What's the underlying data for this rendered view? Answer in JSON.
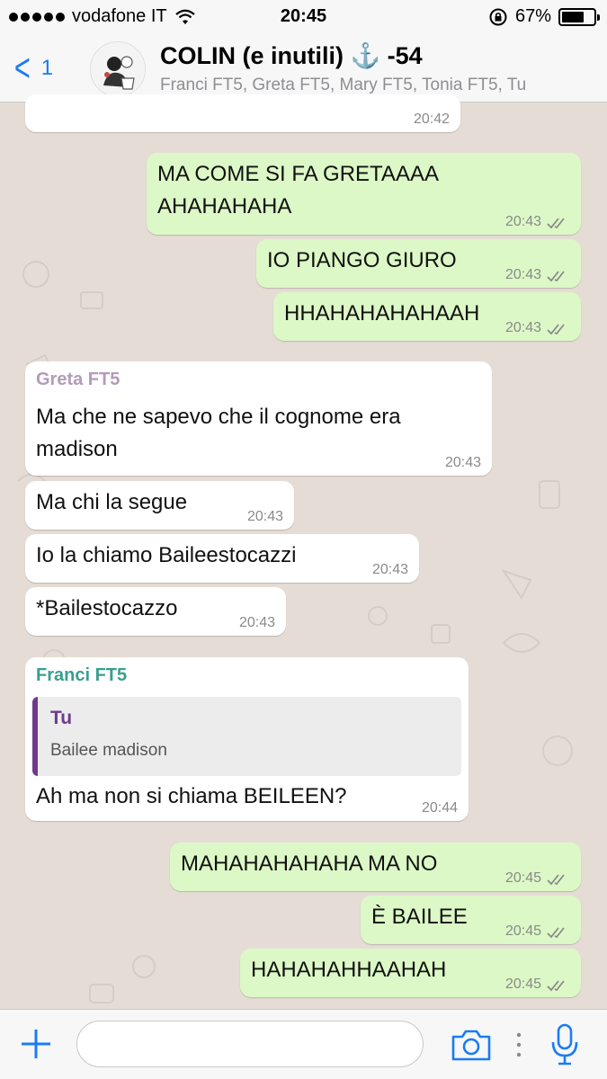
{
  "status_bar": {
    "carrier": "vodafone IT",
    "time": "20:45",
    "battery": "67%",
    "icons": [
      "signal-dots-icon",
      "wifi-icon",
      "orientation-lock-icon",
      "battery-icon"
    ]
  },
  "header": {
    "back_count": "1",
    "title": "COLIN (e inutili) ⚓️ -54",
    "subtitle": "Franci FT5, Greta FT5, Mary FT5, Tonia FT5, Tu"
  },
  "colors": {
    "accent": "#1a7cf5",
    "outgoing_bubble": "#dcf8c6",
    "incoming_bubble": "#ffffff",
    "chat_background": "#e5ddd5",
    "greta_name": "#b39bb8",
    "franci_name": "#3a9e8f",
    "quote_bar": "#6f3a8c",
    "read_ticks": "#8a8a8a"
  },
  "messages": [
    {
      "dir": "in",
      "text": "",
      "time": "20:42"
    },
    {
      "dir": "out",
      "text": "MA COME SI FA GRETAAAA\nAHAHAHAHA",
      "time": "20:43",
      "status": "delivered-double-tick"
    },
    {
      "dir": "out",
      "text": "IO PIANGO GIURO",
      "time": "20:43",
      "status": "delivered-double-tick"
    },
    {
      "dir": "out",
      "text": "HHAHAHAHAHAAH",
      "time": "20:43",
      "status": "delivered-double-tick"
    },
    {
      "dir": "in",
      "sender": "Greta FT5",
      "text": "Ma che ne sapevo che il cognome era\nmadison",
      "time": "20:43"
    },
    {
      "dir": "in",
      "text": "Ma chi la segue",
      "time": "20:43"
    },
    {
      "dir": "in",
      "text": "Io la chiamo Baileestocazzi",
      "time": "20:43"
    },
    {
      "dir": "in",
      "text": "*Bailestocazzo",
      "time": "20:43"
    },
    {
      "dir": "in",
      "sender": "Franci FT5",
      "quote_author": "Tu",
      "quote_text": "Bailee madison",
      "text": "Ah ma non si chiama BEILEEN?",
      "time": "20:44"
    },
    {
      "dir": "out",
      "text": "MAHAHAHAHAHA MA NO",
      "time": "20:45",
      "status": "delivered-double-tick"
    },
    {
      "dir": "out",
      "text": "È BAILEE",
      "time": "20:45",
      "status": "delivered-double-tick"
    },
    {
      "dir": "out",
      "text": "HAHAHAHHAAHAH",
      "time": "20:45",
      "status": "delivered-double-tick"
    }
  ],
  "input_bar": {
    "placeholder": "",
    "icons": [
      "plus-icon",
      "camera-icon",
      "more-dots-icon",
      "microphone-icon"
    ]
  }
}
